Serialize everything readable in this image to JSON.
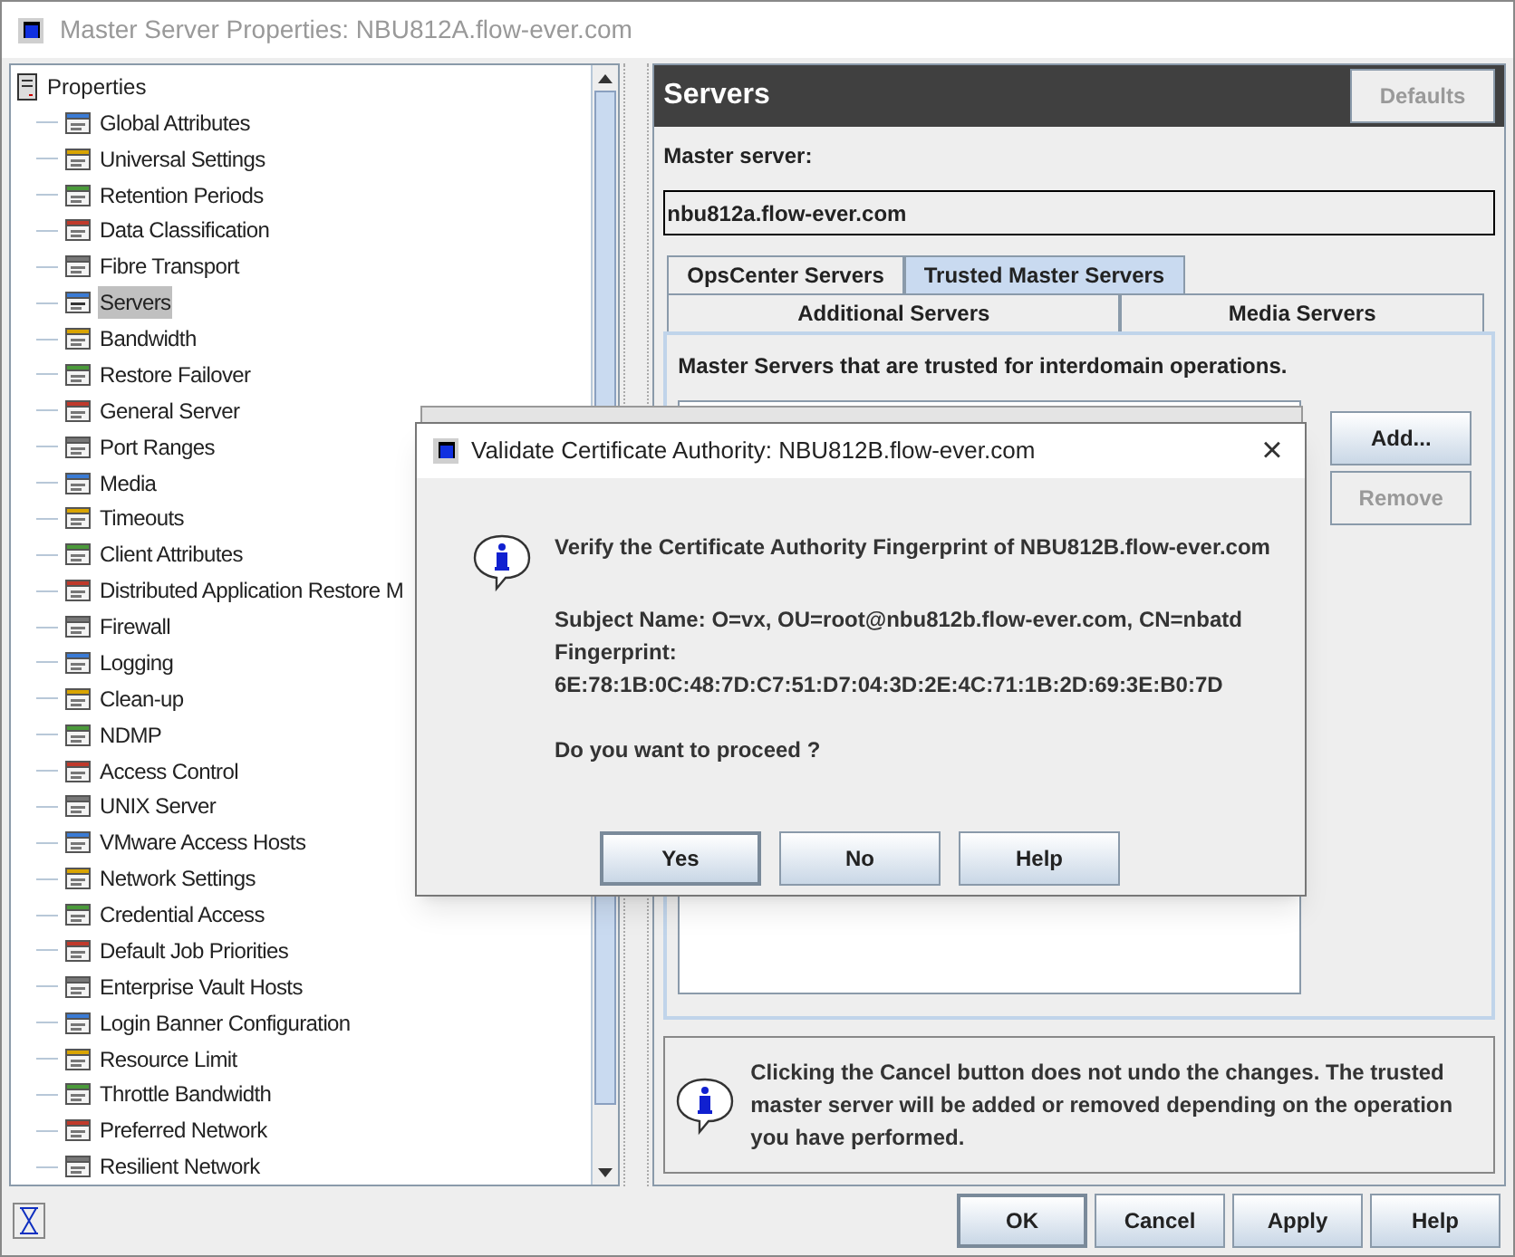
{
  "window": {
    "title": "Master Server Properties: NBU812A.flow-ever.com"
  },
  "tree": {
    "root": "Properties",
    "items": [
      {
        "label": "Global Attributes",
        "selected": false
      },
      {
        "label": "Universal Settings",
        "selected": false
      },
      {
        "label": "Retention Periods",
        "selected": false
      },
      {
        "label": "Data Classification",
        "selected": false
      },
      {
        "label": "Fibre Transport",
        "selected": false
      },
      {
        "label": "Servers",
        "selected": true
      },
      {
        "label": "Bandwidth",
        "selected": false
      },
      {
        "label": "Restore Failover",
        "selected": false
      },
      {
        "label": "General Server",
        "selected": false
      },
      {
        "label": "Port Ranges",
        "selected": false
      },
      {
        "label": "Media",
        "selected": false
      },
      {
        "label": "Timeouts",
        "selected": false
      },
      {
        "label": "Client Attributes",
        "selected": false
      },
      {
        "label": "Distributed Application Restore M",
        "selected": false
      },
      {
        "label": "Firewall",
        "selected": false
      },
      {
        "label": "Logging",
        "selected": false
      },
      {
        "label": "Clean-up",
        "selected": false
      },
      {
        "label": "NDMP",
        "selected": false
      },
      {
        "label": "Access Control",
        "selected": false
      },
      {
        "label": "UNIX Server",
        "selected": false
      },
      {
        "label": "VMware Access Hosts",
        "selected": false
      },
      {
        "label": "Network Settings",
        "selected": false
      },
      {
        "label": "Credential Access",
        "selected": false
      },
      {
        "label": "Default Job Priorities",
        "selected": false
      },
      {
        "label": "Enterprise Vault Hosts",
        "selected": false
      },
      {
        "label": "Login Banner Configuration",
        "selected": false
      },
      {
        "label": "Resource Limit",
        "selected": false
      },
      {
        "label": "Throttle Bandwidth",
        "selected": false
      },
      {
        "label": "Preferred Network",
        "selected": false
      },
      {
        "label": "Resilient Network",
        "selected": false
      }
    ]
  },
  "panel": {
    "title": "Servers",
    "defaults_button": {
      "label": "Defaults",
      "disabled": true
    },
    "master_server_label": "Master server:",
    "master_server_value": "nbu812a.flow-ever.com",
    "tabs_row1": [
      {
        "label": "OpsCenter Servers",
        "selected": false
      },
      {
        "label": "Trusted Master Servers",
        "selected": true
      }
    ],
    "tabs_row2": [
      {
        "label": "Additional Servers",
        "selected": false
      },
      {
        "label": "Media Servers",
        "selected": false
      }
    ],
    "description": "Master Servers that are trusted for interdomain operations.",
    "list_buttons": [
      {
        "label": "Add...",
        "disabled": false
      },
      {
        "label": "Remove",
        "disabled": true
      }
    ],
    "note": "Clicking the Cancel button does not undo the changes. The trusted master server will be added or removed depending on the operation you have performed."
  },
  "buttons": [
    {
      "label": "OK",
      "default": true
    },
    {
      "label": "Cancel",
      "default": false
    },
    {
      "label": "Apply",
      "default": false
    },
    {
      "label": "Help",
      "default": false
    }
  ],
  "dialog": {
    "title": "Validate Certificate Authority: NBU812B.flow-ever.com",
    "close": "×",
    "heading": "Verify the Certificate Authority Fingerprint of NBU812B.flow-ever.com",
    "subject": "Subject Name: O=vx, OU=root@nbu812b.flow-ever.com, CN=nbatd",
    "fingerprint_label": "Fingerprint:",
    "fingerprint": "6E:78:1B:0C:48:7D:C7:51:D7:04:3D:2E:4C:71:1B:2D:69:3E:B0:7D",
    "question": "Do you want to proceed ?",
    "buttons": [
      {
        "label": "Yes",
        "default": true
      },
      {
        "label": "No",
        "default": false
      },
      {
        "label": "Help",
        "default": false
      }
    ]
  }
}
